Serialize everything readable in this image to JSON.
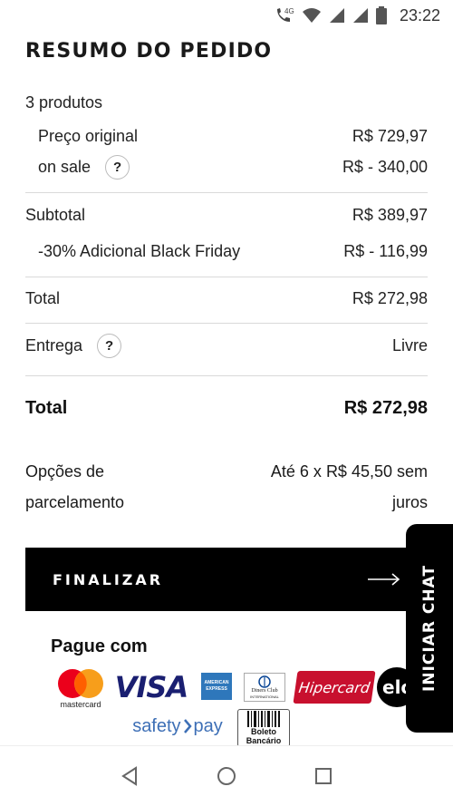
{
  "status_bar": {
    "network": "4G",
    "time": "23:22",
    "icons": [
      "call-icon",
      "wifi-icon",
      "signal-icon",
      "signal-icon",
      "battery-icon"
    ]
  },
  "summary": {
    "title": "RESUMO DO PEDIDO",
    "product_count": "3 produtos",
    "original_price_label": "Preço original",
    "original_price_value": "R$ 729,97",
    "on_sale_label": "on sale",
    "on_sale_value": "R$ - 340,00",
    "subtotal_label": "Subtotal",
    "subtotal_value": "R$ 389,97",
    "discount_label": "-30% Adicional Black Friday",
    "discount_value": "R$ - 116,99",
    "total_label": "Total",
    "total_value": "R$ 272,98",
    "delivery_label": "Entrega",
    "delivery_value": "Livre",
    "grand_total_label": "Total",
    "grand_total_value": "R$ 272,98",
    "help_symbol": "?"
  },
  "installments": {
    "label_line1": "Opções de",
    "label_line2": "parcelamento",
    "value_line1": "Até 6 x R$ 45,50 sem",
    "value_line2": "juros"
  },
  "checkout": {
    "button_label": "FINALIZAR"
  },
  "payment": {
    "title": "Pague com",
    "logos": {
      "mastercard": "mastercard",
      "visa": "VISA",
      "amex": "AMERICAN EXPRESS",
      "diners": "Diners Club",
      "diners_sub": "INTERNATIONAL",
      "hipercard": "Hipercard",
      "elo": "elo",
      "safetypay_a": "safety",
      "safetypay_b": "pay",
      "boleto": "Boleto",
      "boleto_sub": "Bancário"
    }
  },
  "chat": {
    "label": "INICIAR CHAT"
  },
  "colors": {
    "button_bg": "#000000",
    "divider": "#d9d9d9",
    "hipercard": "#c8102e",
    "visa": "#1a1f71",
    "safetypay": "#3d6fb6"
  }
}
